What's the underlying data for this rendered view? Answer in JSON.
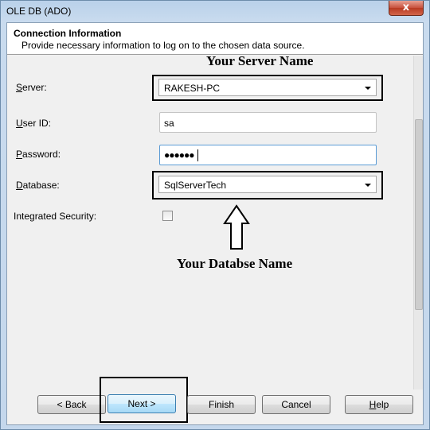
{
  "window": {
    "title": "OLE DB (ADO)",
    "close_glyph": "x"
  },
  "header": {
    "title": "Connection Information",
    "subtitle": "Provide necessary information to log on to the chosen data source."
  },
  "form": {
    "server": {
      "label": "Server:",
      "value": "RAKESH-PC"
    },
    "user_id": {
      "label": "User ID:",
      "value": "sa"
    },
    "password": {
      "label": "Password:",
      "value": "●●●●●●"
    },
    "database": {
      "label": "Database:",
      "value": "SqlServerTech"
    },
    "integrated_security": {
      "label": "Integrated Security:",
      "checked": false
    }
  },
  "annotations": {
    "server_note": "Your Server Name",
    "database_note": "Your Databse Name"
  },
  "buttons": {
    "back": "< Back",
    "next": "Next >",
    "finish": "Finish",
    "cancel": "Cancel",
    "help": "Help"
  }
}
